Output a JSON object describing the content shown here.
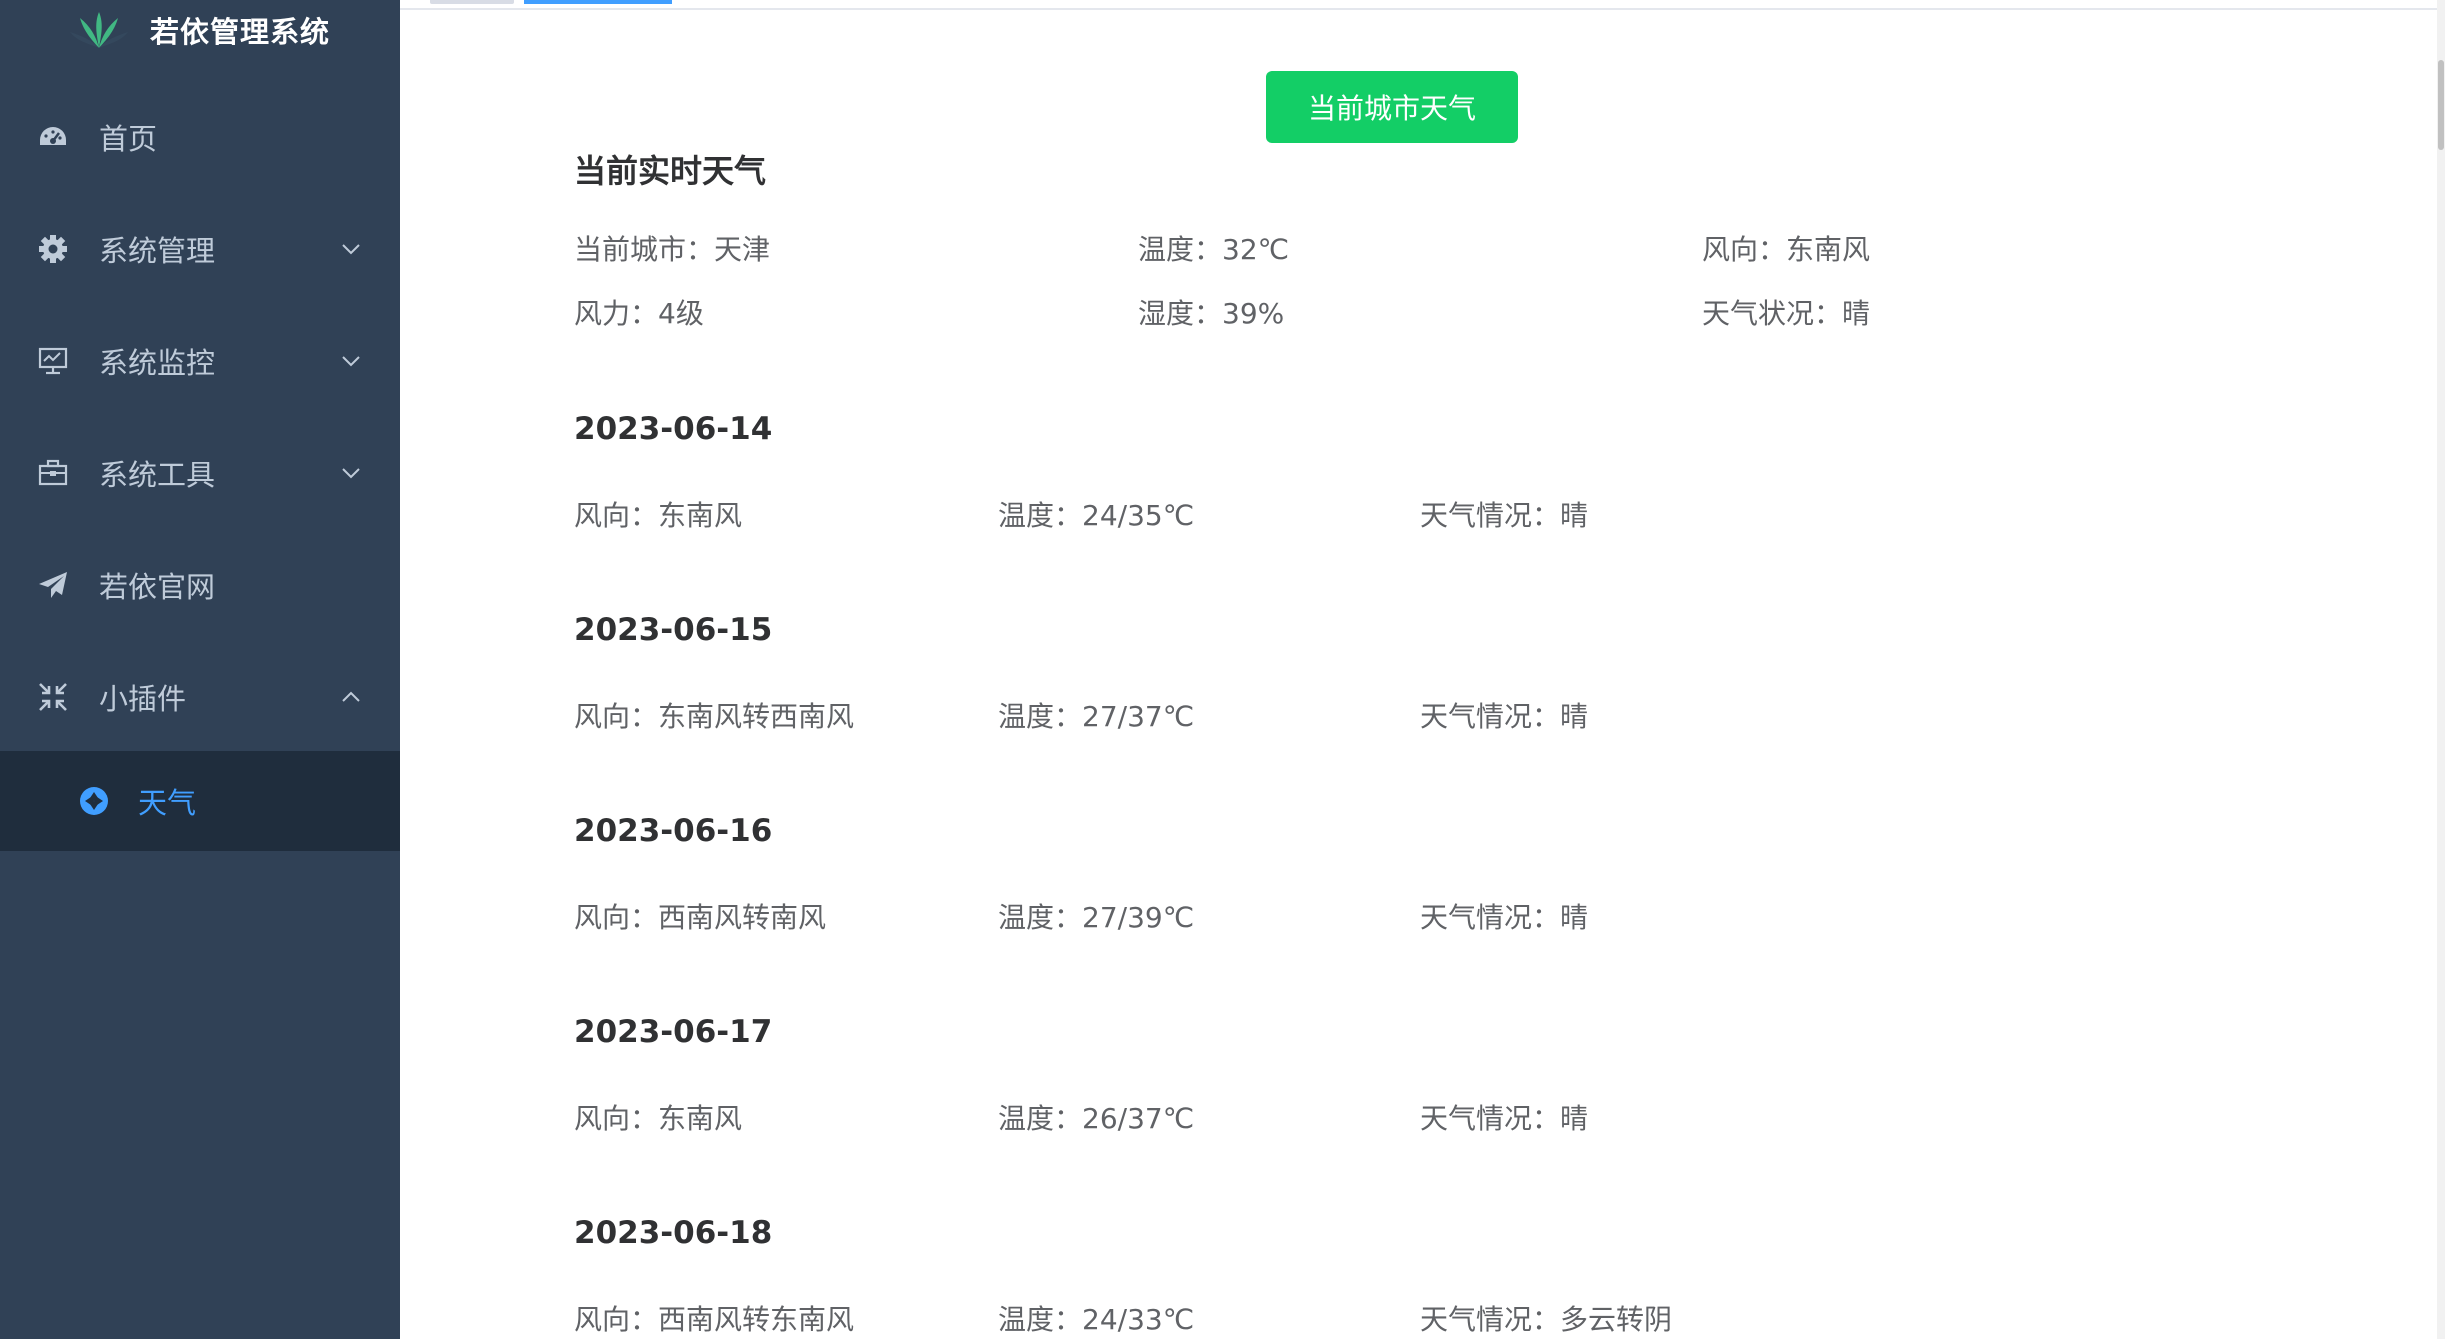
{
  "sidebar": {
    "brand_title": "若依管理系统",
    "items": [
      {
        "label": "首页",
        "icon": "dashboard-icon"
      },
      {
        "label": "系统管理",
        "icon": "gear-icon",
        "arrow": "chevron-down-icon"
      },
      {
        "label": "系统监控",
        "icon": "monitor-icon",
        "arrow": "chevron-down-icon"
      },
      {
        "label": "系统工具",
        "icon": "toolbox-icon",
        "arrow": "chevron-down-icon"
      },
      {
        "label": "若依官网",
        "icon": "paper-plane-icon"
      },
      {
        "label": "小插件",
        "icon": "compress-icon",
        "arrow": "chevron-up-icon"
      }
    ],
    "submenu": {
      "label": "天气",
      "icon": "weather-icon",
      "color": "#409eff"
    },
    "bg_color": "#304156",
    "active_bg_color": "#1f2d3d"
  },
  "main": {
    "city_button": {
      "label": "当前城市天气",
      "color": "#13ce66"
    },
    "section_title": "当前实时天气",
    "current": [
      {
        "key": "当前城市",
        "value": "天津"
      },
      {
        "key": "温度",
        "value": "32℃"
      },
      {
        "key": "风向",
        "value": "东南风"
      },
      {
        "key": "风力",
        "value": "4级"
      },
      {
        "key": "湿度",
        "value": "39%"
      },
      {
        "key": "天气状况",
        "value": "晴"
      }
    ],
    "forecast": [
      {
        "date": "2023-06-14",
        "wind_key": "风向",
        "wind": "东南风",
        "temp_key": "温度",
        "temp": "24/35℃",
        "cond_key": "天气情况",
        "cond": "晴"
      },
      {
        "date": "2023-06-15",
        "wind_key": "风向",
        "wind": "东南风转西南风",
        "temp_key": "温度",
        "temp": "27/37℃",
        "cond_key": "天气情况",
        "cond": "晴"
      },
      {
        "date": "2023-06-16",
        "wind_key": "风向",
        "wind": "西南风转南风",
        "temp_key": "温度",
        "temp": "27/39℃",
        "cond_key": "天气情况",
        "cond": "晴"
      },
      {
        "date": "2023-06-17",
        "wind_key": "风向",
        "wind": "东南风",
        "temp_key": "温度",
        "temp": "26/37℃",
        "cond_key": "天气情况",
        "cond": "晴"
      },
      {
        "date": "2023-06-18",
        "wind_key": "风向",
        "wind": "西南风转东南风",
        "temp_key": "温度",
        "temp": "24/33℃",
        "cond_key": "天气情况",
        "cond": "多云转阴"
      }
    ]
  }
}
